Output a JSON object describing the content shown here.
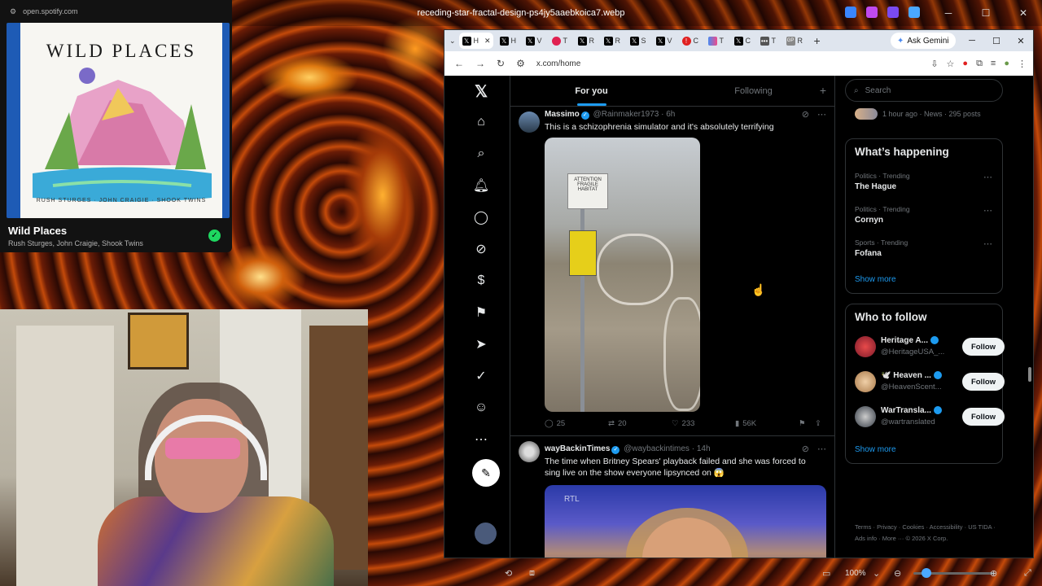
{
  "viewer": {
    "title": "receding-star-fractal-design-ps4jy5aaebkoica7.webp",
    "zoom": "100%"
  },
  "spotify": {
    "url": "open.spotify.com",
    "album_art_title": "WILD PLACES",
    "album_art_artists": "RUSH STURGES · JOHN CRAIGIE · SHOOK TWINS",
    "title": "Wild Places",
    "artists": "Rush Sturges, John Craigie, Shook Twins"
  },
  "browser": {
    "tabs": [
      {
        "label": "H",
        "icon": "x-favicon"
      },
      {
        "label": "H",
        "icon": "x-favicon"
      },
      {
        "label": "V",
        "icon": "x-favicon"
      },
      {
        "label": "T",
        "icon": "red-favicon"
      },
      {
        "label": "R",
        "icon": "x-favicon"
      },
      {
        "label": "R",
        "icon": "x-favicon"
      },
      {
        "label": "S",
        "icon": "x-favicon"
      },
      {
        "label": "V",
        "icon": "x-favicon"
      },
      {
        "label": "C",
        "icon": "red-favicon"
      },
      {
        "label": "T",
        "icon": "colorful-favicon"
      },
      {
        "label": "C",
        "icon": "x-favicon"
      },
      {
        "label": "T",
        "icon": "dots-favicon"
      },
      {
        "label": "R",
        "icon": "gp-favicon"
      }
    ],
    "gemini_label": "Ask Gemini",
    "url": "x.com/home"
  },
  "x": {
    "feed_tabs": {
      "for_you": "For you",
      "following": "Following"
    },
    "posts": [
      {
        "name": "Massimo",
        "handle": "@Rainmaker1973",
        "time": "6h",
        "text": "This is a schizophrenia simulator and it's absolutely terrifying",
        "sign_text": "ATTENTION FRAGILE HABITAT",
        "replies": "25",
        "reposts": "20",
        "likes": "233",
        "views": "56K"
      },
      {
        "name": "wayBackinTimes",
        "handle": "@waybackintimes",
        "time": "14h",
        "text": "The time when Britney Spears' playback failed and she was forced to sing live on the show everyone lipsynced on 😱",
        "media_logo": "RTL"
      }
    ],
    "search_placeholder": "Search",
    "news_line": "1 hour ago · News · 295 posts",
    "whats_happening": {
      "title": "What’s happening",
      "trends": [
        {
          "category": "Politics · Trending",
          "name": "The Hague"
        },
        {
          "category": "Politics · Trending",
          "name": "Cornyn"
        },
        {
          "category": "Sports · Trending",
          "name": "Fofana"
        }
      ],
      "show_more": "Show more"
    },
    "who_to_follow": {
      "title": "Who to follow",
      "accounts": [
        {
          "name": "Heritage A...",
          "handle": "@HeritageUSA_...",
          "button": "Follow"
        },
        {
          "name": "🕊️ Heaven ...",
          "handle": "@HeavenScent...",
          "button": "Follow"
        },
        {
          "name": "WarTransla...",
          "handle": "@wartranslated",
          "button": "Follow"
        }
      ],
      "show_more": "Show more"
    },
    "footer": "Terms · Privacy · Cookies · Accessibility · US TIDA · Ads info · More ··· © 2026 X Corp."
  }
}
